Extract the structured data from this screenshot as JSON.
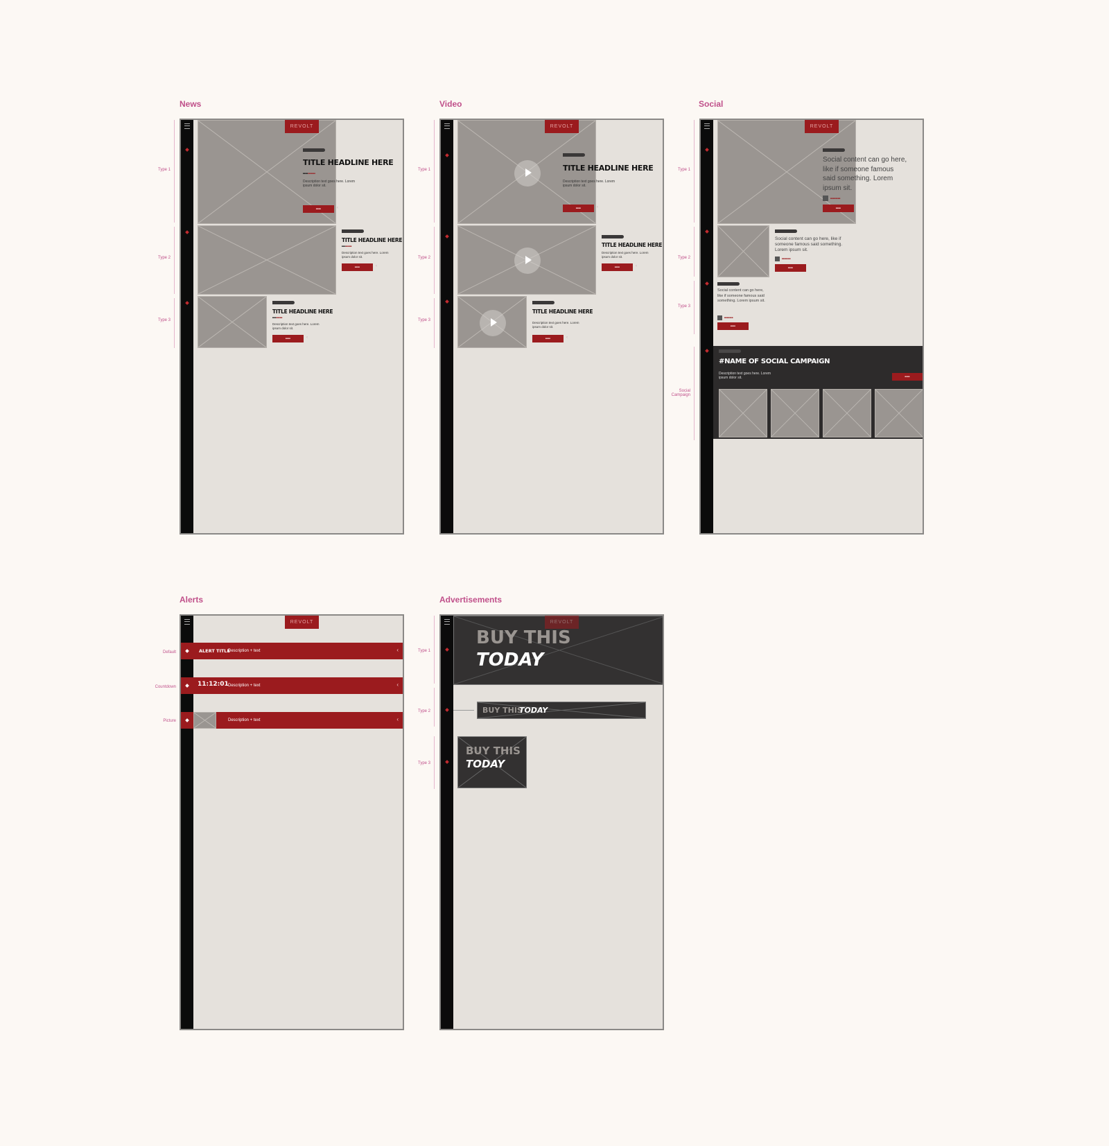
{
  "sections": {
    "news": "News",
    "video": "Video",
    "social": "Social",
    "alerts": "Alerts",
    "advertisements": "Advertisements"
  },
  "brand": {
    "logo": "REVOLT",
    "accent": "#9b1b1e",
    "label_color": "#c0508a"
  },
  "labels": {
    "type1": "Type 1",
    "type2": "Type 2",
    "type3": "Type 3",
    "social_campaign": "Social Campaign",
    "default": "Default",
    "countdown": "Countdown",
    "picture": "Picture"
  },
  "news": {
    "headline": "TITLE HEADLINE HERE",
    "desc_type1": "Description text goes here. Lorem ipsum dolor sit.",
    "desc_short": "Description text goes here. Lorem ipsum dolor sit."
  },
  "video": {
    "headline": "TITLE HEADLINE HERE",
    "desc_type1": "Description text goes here. Lorem ipsum dolor sit.",
    "desc_short": "Description text goes here. Lorem ipsum dolor sit."
  },
  "social": {
    "text_type1": "Social content can go here, like if someone famous said something. Lorem ipsum sit.",
    "text_type2": "Social content can go here, like if someone famous said something. Lorem ipsum sit.",
    "text_type3": "Social content can go here, like if someone famous said something. Lorem ipsum sit.",
    "campaign_title": "#NAME OF SOCIAL CAMPAIGN",
    "campaign_desc": "Description text goes here. Lorem ipsum dolor sit."
  },
  "alerts": {
    "alert_title": "ALERT TITLE",
    "description": "Description + text",
    "countdown": "11:12:01"
  },
  "ads": {
    "line1": "BUY THIS",
    "line2": "TODAY"
  }
}
